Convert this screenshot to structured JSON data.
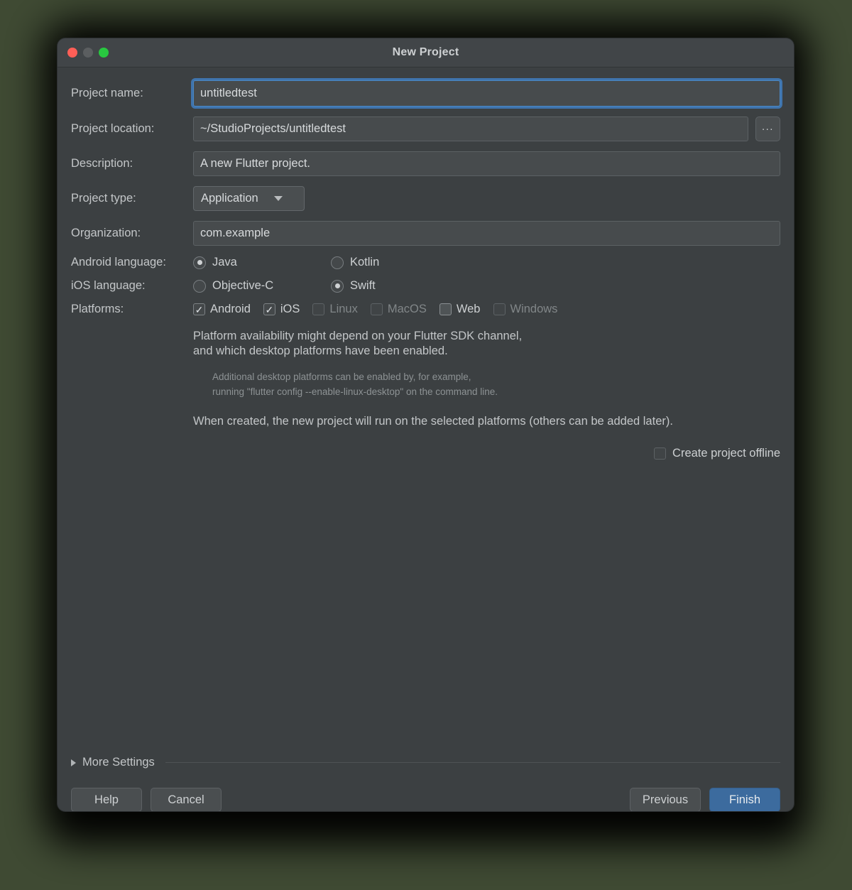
{
  "window": {
    "title": "New Project",
    "traffic_lights": [
      "close-button",
      "minimize-button",
      "maximize-button"
    ]
  },
  "form": {
    "project_name": {
      "label": "Project name:",
      "value": "untitledtest",
      "focused": true
    },
    "project_location": {
      "label": "Project location:",
      "value": "~/StudioProjects/untitledtest",
      "browse_label": "..."
    },
    "description": {
      "label": "Description:",
      "value": "A new Flutter project."
    },
    "project_type": {
      "label": "Project type:",
      "value": "Application",
      "options": [
        "Application"
      ]
    },
    "organization": {
      "label": "Organization:",
      "value": "com.example"
    },
    "android_language": {
      "label": "Android language:",
      "options": [
        {
          "label": "Java",
          "selected": true
        },
        {
          "label": "Kotlin",
          "selected": false
        }
      ]
    },
    "ios_language": {
      "label": "iOS language:",
      "options": [
        {
          "label": "Objective-C",
          "selected": false
        },
        {
          "label": "Swift",
          "selected": true
        }
      ]
    },
    "platforms": {
      "label": "Platforms:",
      "options": [
        {
          "label": "Android",
          "checked": true,
          "enabled": true
        },
        {
          "label": "iOS",
          "checked": true,
          "enabled": true
        },
        {
          "label": "Linux",
          "checked": false,
          "enabled": false
        },
        {
          "label": "MacOS",
          "checked": false,
          "enabled": false
        },
        {
          "label": "Web",
          "checked": false,
          "enabled": true
        },
        {
          "label": "Windows",
          "checked": false,
          "enabled": false
        }
      ]
    }
  },
  "notes": {
    "availability_line1": "Platform availability might depend on your Flutter SDK channel,",
    "availability_line2": "and which desktop platforms have been enabled.",
    "sub_line1": "Additional desktop platforms can be enabled by, for example,",
    "sub_line2": "running \"flutter config --enable-linux-desktop\" on the command line.",
    "when_created": "When created, the new project will run on the selected platforms (others can be added later)."
  },
  "offline": {
    "label": "Create project offline",
    "checked": false
  },
  "more_settings": {
    "label": "More Settings",
    "expanded": false
  },
  "footer": {
    "help": "Help",
    "cancel": "Cancel",
    "previous": "Previous",
    "finish": "Finish"
  },
  "colors": {
    "page_background": "#3f4a33",
    "dialog_background": "#3c4042",
    "titlebar_background": "#414548",
    "field_background": "#474b4d",
    "accent_focus": "#3f7ec0",
    "primary_button": "#3c6b9e",
    "text": "#c3c6c8",
    "text_dim": "#8d9294",
    "light_close": "#ff5f57",
    "light_min": "#5b5e60",
    "light_max": "#28c840"
  }
}
